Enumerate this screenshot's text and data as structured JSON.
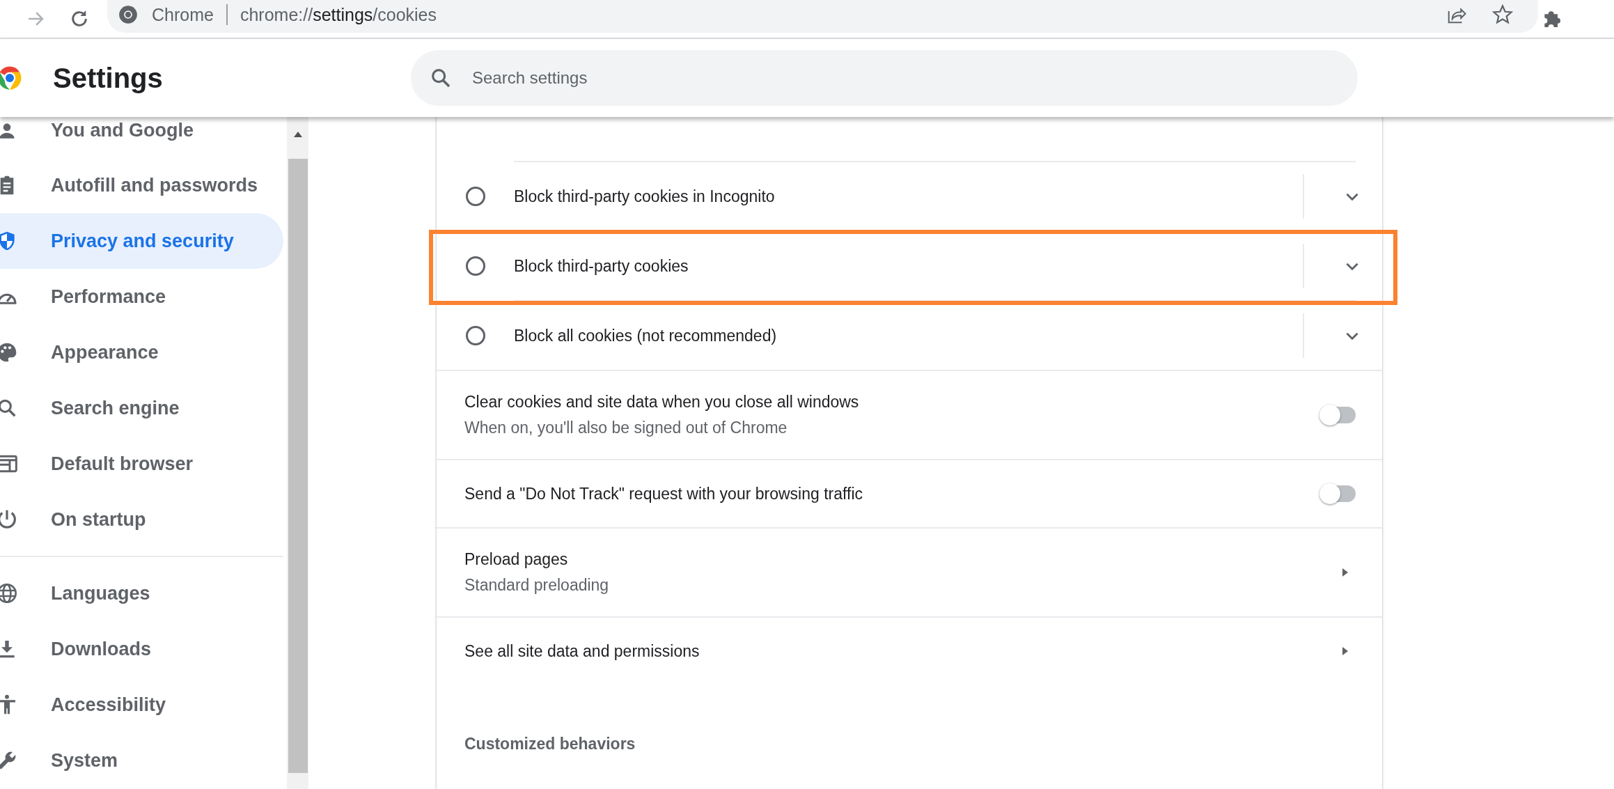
{
  "toolbar": {
    "site_label": "Chrome",
    "url": "chrome://settings/cookies"
  },
  "header": {
    "title": "Settings",
    "search": {
      "placeholder": "Search settings"
    }
  },
  "sidebar": {
    "items": [
      {
        "label": "You and Google",
        "selected": false
      },
      {
        "label": "Autofill and passwords",
        "selected": false
      },
      {
        "label": "Privacy and security",
        "selected": true
      },
      {
        "label": "Performance",
        "selected": false
      },
      {
        "label": "Appearance",
        "selected": false
      },
      {
        "label": "Search engine",
        "selected": false
      },
      {
        "label": "Default browser",
        "selected": false
      },
      {
        "label": "On startup",
        "selected": false,
        "divider_after": true
      },
      {
        "label": "Languages",
        "selected": false
      },
      {
        "label": "Downloads",
        "selected": false
      },
      {
        "label": "Accessibility",
        "selected": false
      },
      {
        "label": "System",
        "selected": false
      }
    ]
  },
  "cookie_options": [
    {
      "label": "Block third-party cookies in Incognito",
      "selected": false,
      "highlighted": false
    },
    {
      "label": "Block third-party cookies",
      "selected": false,
      "highlighted": true
    },
    {
      "label": "Block all cookies (not recommended)",
      "selected": false,
      "highlighted": false
    }
  ],
  "settings": [
    {
      "kind": "toggle",
      "label": "Clear cookies and site data when you close all windows",
      "sublabel": "When on, you'll also be signed out of Chrome",
      "on": false
    },
    {
      "kind": "toggle",
      "label": "Send a \"Do Not Track\" request with your browsing traffic",
      "on": false
    },
    {
      "kind": "link",
      "label": "Preload pages",
      "sublabel": "Standard preloading"
    },
    {
      "kind": "link",
      "label": "See all site data and permissions"
    }
  ],
  "section_heading": "Customized behaviors"
}
